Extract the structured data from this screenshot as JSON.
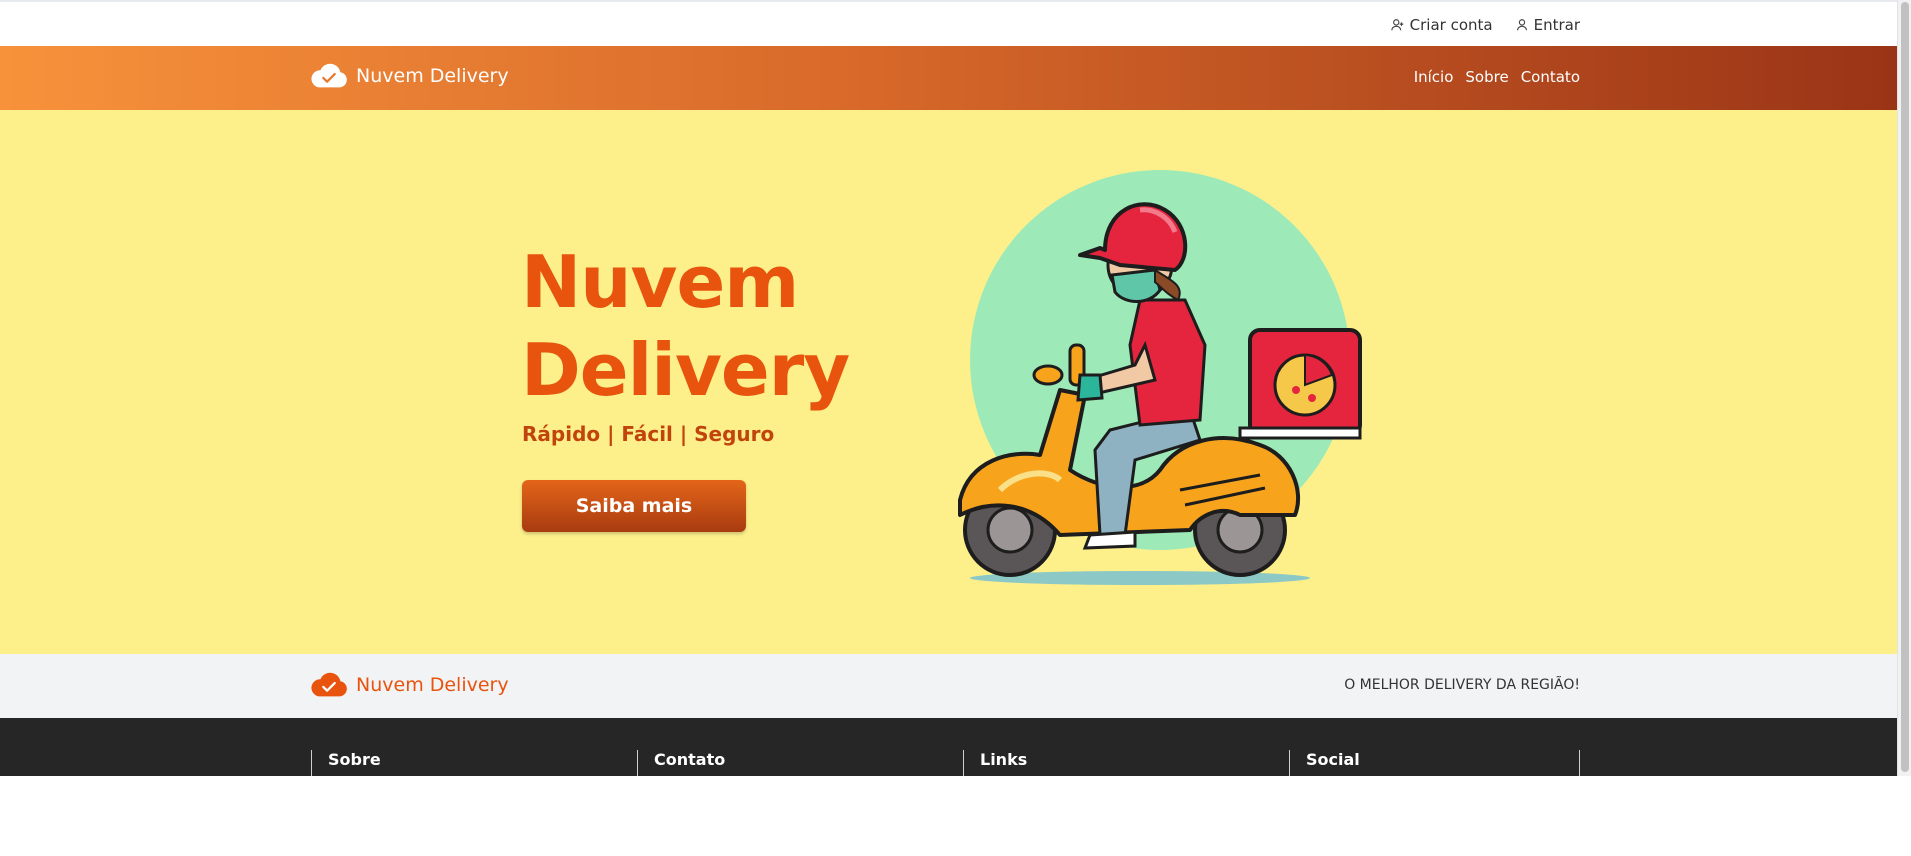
{
  "topbar": {
    "create_account": "Criar conta",
    "login": "Entrar"
  },
  "nav": {
    "brand": "Nuvem Delivery",
    "items": [
      {
        "label": "Início"
      },
      {
        "label": "Sobre"
      },
      {
        "label": "Contato"
      }
    ]
  },
  "hero": {
    "title_line1": "Nuvem",
    "title_line2": "Delivery",
    "subtitle": "Rápido | Fácil | Seguro",
    "button": "Saiba mais"
  },
  "footer_strip": {
    "brand": "Nuvem Delivery",
    "tagline": "O MELHOR DELIVERY DA REGIÃO!"
  },
  "footer": {
    "columns": [
      {
        "title": "Sobre"
      },
      {
        "title": "Contato"
      },
      {
        "title": "Links"
      },
      {
        "title": "Social"
      }
    ]
  },
  "colors": {
    "accent": "#e8540e",
    "nav_gradient_start": "#f7923b",
    "nav_gradient_end": "#9a3416",
    "hero_bg": "#fdf08b",
    "footer_dark": "#262626",
    "footer_light": "#f2f3f5"
  },
  "icons": [
    "user-plus-icon",
    "user-icon",
    "cloud-check-icon"
  ]
}
